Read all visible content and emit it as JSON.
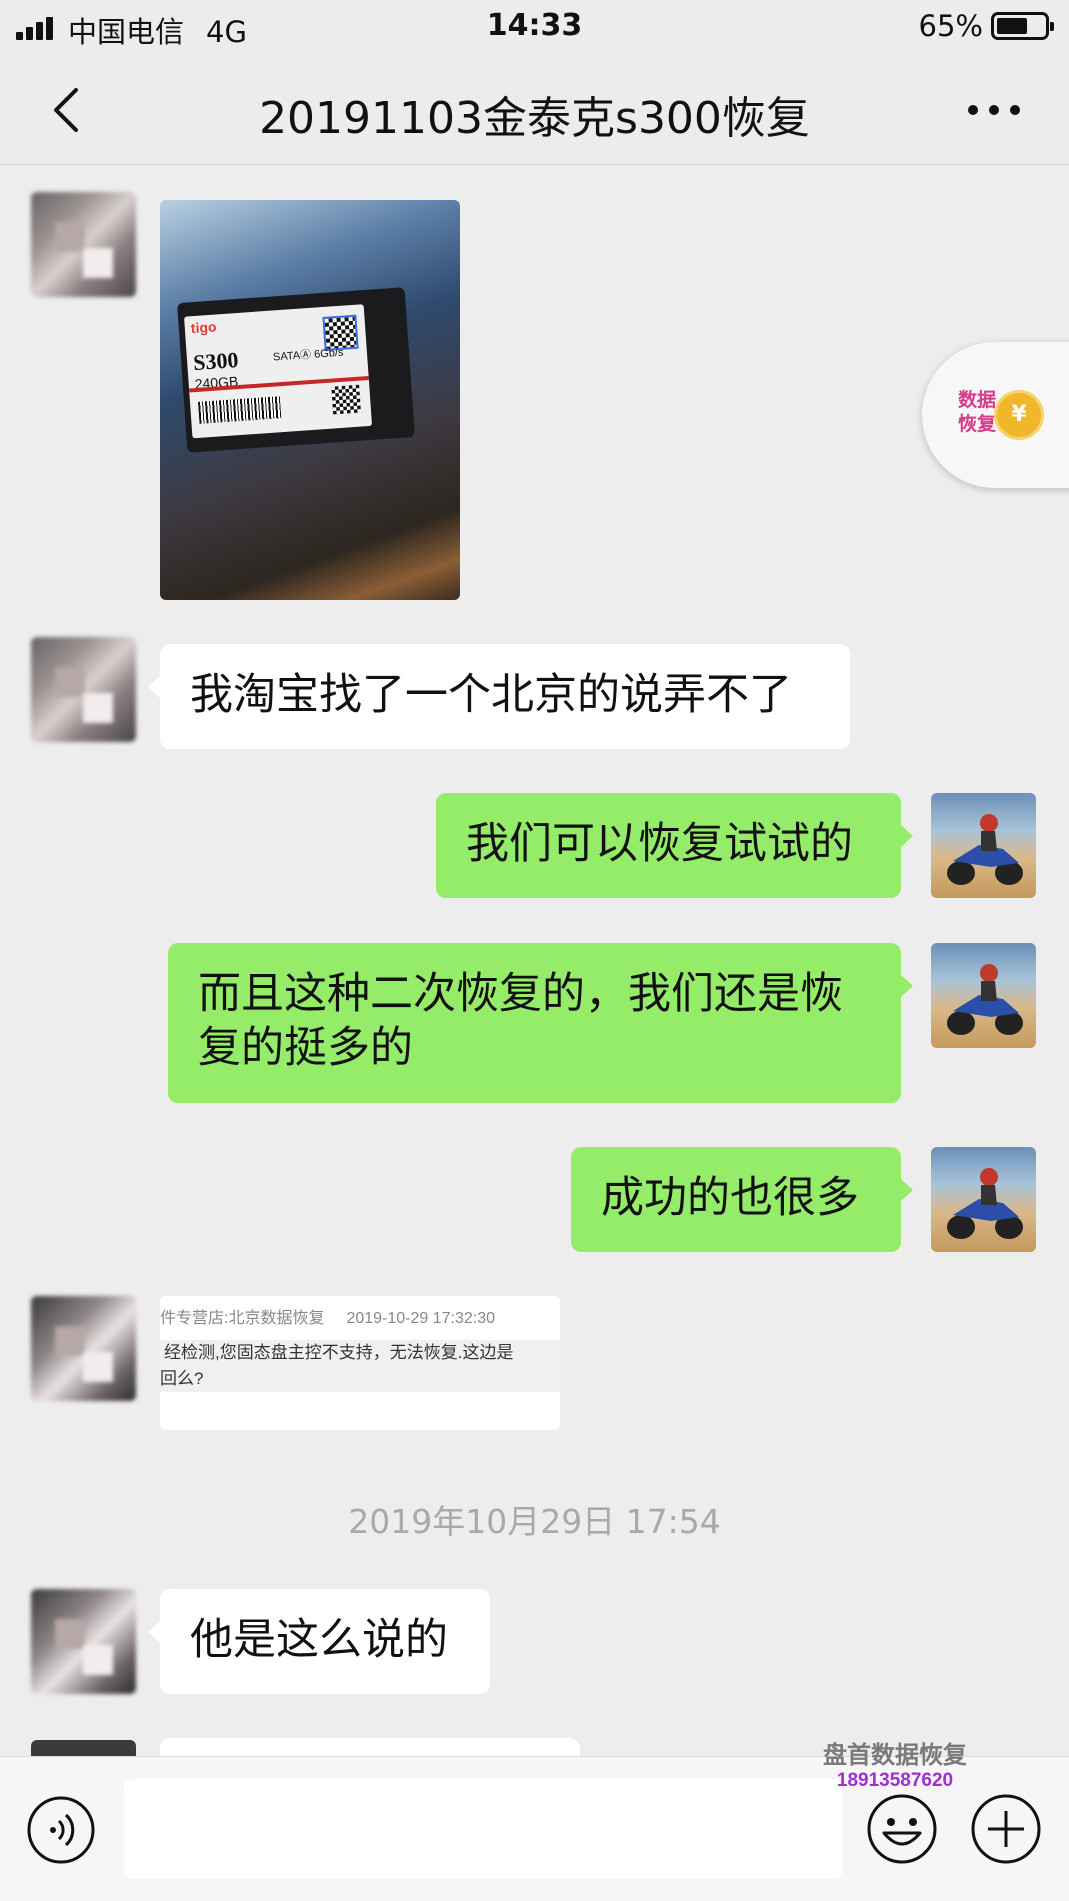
{
  "status_bar": {
    "carrier": "中国电信",
    "network": "4G",
    "time": "14:33",
    "battery_percent": "65%",
    "battery_level": 0.65
  },
  "nav": {
    "title": "20191103金泰克s300恢复",
    "back_icon": "chevron-left-icon",
    "more_icon": "more-dots-icon"
  },
  "photo": {
    "brand": "tigo",
    "model": "S300",
    "capacity": "240GB",
    "interface": "SATAⒶ 6Gb/s"
  },
  "messages": [
    {
      "side": "left",
      "text": "我淘宝找了一个北京的说弄不了"
    },
    {
      "side": "right",
      "text": "我们可以恢复试试的"
    },
    {
      "side": "right",
      "text": "而且这种二次恢复的，我们还是恢复的挺多的"
    },
    {
      "side": "right",
      "text": "成功的也很多"
    },
    {
      "side": "left",
      "text": "他是这么说的"
    }
  ],
  "quote": {
    "shop": "件专营店:北京数据恢复",
    "date": "2019-10-29 17:32:30",
    "line1": "经检测,您固态盘主控不支持，无法恢复.这边是",
    "line2": "回么?"
  },
  "timestamp": "2019年10月29日 17:54",
  "float_widget": {
    "text": "数据恢复",
    "coin_symbol": "¥"
  },
  "input_bar": {
    "placeholder": "",
    "voice_icon": "voice-icon",
    "emoji_icon": "emoji-icon",
    "plus_icon": "plus-icon"
  },
  "watermark": {
    "name": "盘首数据恢复",
    "phone": "18913587620"
  },
  "colors": {
    "chat_background": "#ededed",
    "my_bubble": "#95ec69",
    "their_bubble": "#ffffff"
  }
}
